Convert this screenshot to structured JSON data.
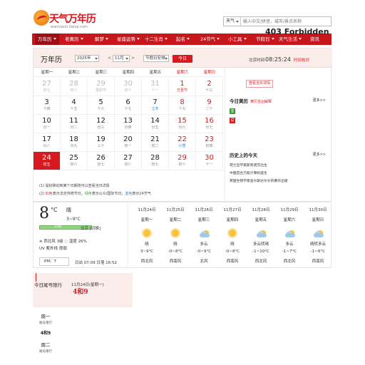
{
  "header": {
    "logo_text": "天气万年历",
    "logo_sub": "wannianli.tianqi.com",
    "search_type": "天气",
    "search_placeholder": "输入中文/拼音，城市/景点名称"
  },
  "nav": {
    "items": [
      "万年历",
      "老黄历",
      "解梦",
      "星座运势",
      "十二生肖",
      "起名",
      "24节气",
      "小工具",
      "节假日",
      "天气生活",
      "资讯"
    ],
    "overlay_text": "403 Forbidden"
  },
  "calendar": {
    "title": "万年历",
    "year": "2025年",
    "month": "11月",
    "holiday_select": "节假日安排",
    "today_label": "今日",
    "bj_time_label": "北京时间",
    "bj_time": "08:25:24",
    "calibrate": "时间校对",
    "weekdays": [
      "星期一",
      "星期二",
      "星期三",
      "星期四",
      "星期五",
      "星期六",
      "星期日"
    ],
    "days": [
      {
        "n": "27",
        "l": "初七",
        "t": "other"
      },
      {
        "n": "28",
        "l": "初八",
        "t": "other"
      },
      {
        "n": "29",
        "l": "重阳节",
        "t": "other"
      },
      {
        "n": "30",
        "l": "初十",
        "t": "other"
      },
      {
        "n": "31",
        "l": "十一",
        "t": "other"
      },
      {
        "n": "1",
        "l": "万圣节",
        "t": "weekend hol"
      },
      {
        "n": "2",
        "l": "十三",
        "t": "weekend"
      },
      {
        "n": "3",
        "l": "十四",
        "t": ""
      },
      {
        "n": "4",
        "l": "十五",
        "t": ""
      },
      {
        "n": "5",
        "l": "十六",
        "t": ""
      },
      {
        "n": "6",
        "l": "十七",
        "t": ""
      },
      {
        "n": "7",
        "l": "立冬",
        "t": "term"
      },
      {
        "n": "8",
        "l": "十九",
        "t": "weekend"
      },
      {
        "n": "9",
        "l": "二十",
        "t": "weekend"
      },
      {
        "n": "10",
        "l": "廿一",
        "t": ""
      },
      {
        "n": "11",
        "l": "廿二",
        "t": ""
      },
      {
        "n": "12",
        "l": "廿三",
        "t": ""
      },
      {
        "n": "13",
        "l": "廿四",
        "t": ""
      },
      {
        "n": "14",
        "l": "廿五",
        "t": ""
      },
      {
        "n": "15",
        "l": "廿六",
        "t": "weekend"
      },
      {
        "n": "16",
        "l": "廿七",
        "t": "weekend"
      },
      {
        "n": "17",
        "l": "廿八",
        "t": ""
      },
      {
        "n": "18",
        "l": "廿九",
        "t": ""
      },
      {
        "n": "19",
        "l": "三十",
        "t": ""
      },
      {
        "n": "20",
        "l": "初一",
        "t": ""
      },
      {
        "n": "21",
        "l": "初二",
        "t": ""
      },
      {
        "n": "22",
        "l": "小雪",
        "t": "weekend term"
      },
      {
        "n": "23",
        "l": "初四",
        "t": "weekend"
      },
      {
        "n": "24",
        "l": "初五",
        "t": "today"
      },
      {
        "n": "25",
        "l": "初六",
        "t": ""
      },
      {
        "n": "26",
        "l": "初七",
        "t": ""
      },
      {
        "n": "27",
        "l": "初八",
        "t": ""
      },
      {
        "n": "28",
        "l": "初九",
        "t": ""
      },
      {
        "n": "29",
        "l": "初十",
        "t": "weekend"
      },
      {
        "n": "30",
        "l": "十一",
        "t": "weekend"
      }
    ],
    "note1": "(1) 鼠标移动到某个日期将可以查看当日详情",
    "note2_a": "(2) ",
    "note2_red": "红色",
    "note2_b": "表示法定传统节日，",
    "note2_green": "绿色",
    "note2_c": "表示公众/国际节日，",
    "note2_blue": "蓝色",
    "note2_d": "表示24节气"
  },
  "side": {
    "detail_btn": "查看当日详情",
    "yj_title": "今日黄历",
    "yj_sub": "黄历吉凶解释",
    "more": "更多>>",
    "yi": "宜",
    "ji": "忌",
    "hist_title": "历史上的今天",
    "hist": [
      "荷兰哲学家斯宾诺莎出生",
      "中国首台万能计算机诞生",
      "英国生物学家查尔斯达尔文的著作出版"
    ]
  },
  "weather": {
    "temp": "8",
    "deg": "°C",
    "cond": "晴",
    "range": "3~9°C",
    "aqi": "33优",
    "city": "北京 [切换]",
    "wind": "西北风 3级",
    "humidity": "湿度 26%",
    "uv": "UV 紫外线 很弱",
    "pm": "PM：7",
    "sun": "日出 07:09  日落 16:52",
    "forecast": [
      {
        "d": "11月24日",
        "wk": "星期一",
        "icon": "sun",
        "c": "晴",
        "t": "3~9°C",
        "wd": "西北风"
      },
      {
        "d": "11月25日",
        "wk": "星期二",
        "icon": "sun",
        "c": "晴",
        "t": "-0~8°C",
        "wd": "西南风"
      },
      {
        "d": "11月26日",
        "wk": "星期三",
        "icon": "cloud",
        "c": "多云",
        "t": "-0~9°C",
        "wd": "北风"
      },
      {
        "d": "11月27日",
        "wk": "星期四",
        "icon": "sun",
        "c": "晴",
        "t": "-0~8°C",
        "wd": "西南风"
      },
      {
        "d": "11月28日",
        "wk": "星期五",
        "icon": "cloud",
        "c": "多云转晴",
        "t": "-1~10°C",
        "wd": "西北风"
      },
      {
        "d": "11月29日",
        "wk": "星期六",
        "icon": "cloud",
        "c": "多云",
        "t": "-1~7°C",
        "wd": "西北风"
      },
      {
        "d": "11月30日",
        "wk": "星期日",
        "icon": "cloud",
        "c": "晴转多云",
        "t": "-1~6°C",
        "wd": "西南风"
      }
    ]
  },
  "limit": {
    "title": "今日尾号限行",
    "date": "11月24日(星期一)",
    "value": "4和9",
    "days": [
      {
        "a": "周一",
        "b": "尾号限行",
        "c": "4和9"
      },
      {
        "a": "周二",
        "b": "尾号限行",
        "c": ""
      }
    ]
  }
}
